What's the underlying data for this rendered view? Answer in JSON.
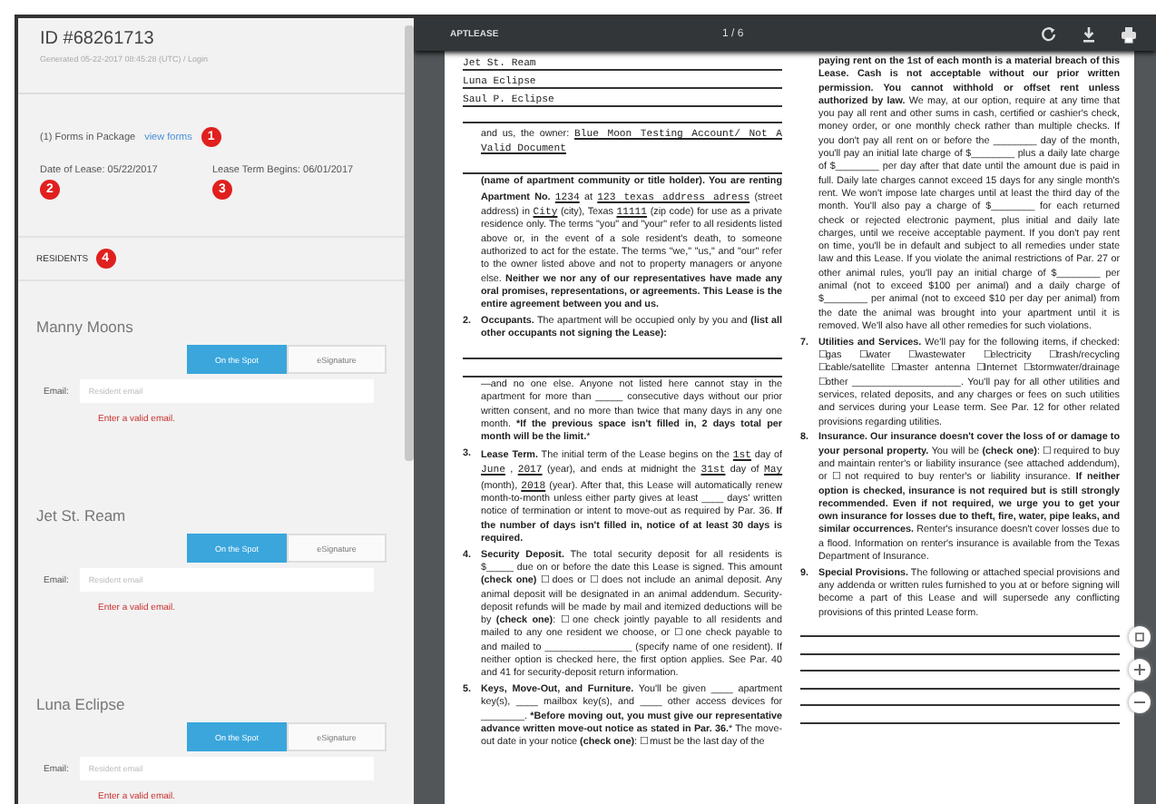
{
  "lease": {
    "id": "ID #68261713",
    "generated": "Generated 05-22-2017 08:45:28 (UTC) / Login",
    "forms_label": "(1) Forms in Package",
    "forms_link": "view forms",
    "date_of_lease_label": "Date of Lease:",
    "date_of_lease": "05/22/2017",
    "term_begins_label": "Lease Term Begins:",
    "term_begins": "06/01/2017",
    "residents_heading": "RESIDENTS"
  },
  "callouts": [
    "1",
    "2",
    "3",
    "4"
  ],
  "residents": [
    {
      "name": "Manny Moons",
      "options": [
        {
          "label": "On the Spot",
          "selected": true
        },
        {
          "label": "eSignature",
          "selected": false
        }
      ],
      "email_label": "Email:",
      "email_placeholder": "Resident email",
      "error": "Enter a valid email."
    },
    {
      "name": "Jet St. Ream",
      "options": [
        {
          "label": "On the Spot",
          "selected": true
        },
        {
          "label": "eSignature",
          "selected": false
        }
      ],
      "email_label": "Email:",
      "email_placeholder": "Resident email",
      "error": "Enter a valid email."
    },
    {
      "name": "Luna Eclipse",
      "options": [
        {
          "label": "On the Spot",
          "selected": true
        },
        {
          "label": "eSignature",
          "selected": false
        }
      ],
      "email_label": "Email:",
      "email_placeholder": "Resident email",
      "error": "Enter a valid email."
    }
  ],
  "viewer": {
    "title": "APTLEASE",
    "page": "1 / 6"
  },
  "document": {
    "columns": [
      [
        {
          "kind": "fill_line",
          "text": "Jet St. Ream"
        },
        {
          "kind": "fill_line",
          "text": "Luna Eclipse"
        },
        {
          "kind": "fill_line",
          "text": "Saul P. Eclipse"
        },
        {
          "kind": "rule"
        },
        {
          "kind": "para",
          "parts": [
            {
              "kind": "text",
              "text": "and us, the owner:"
            },
            {
              "kind": "fill",
              "text": "Blue Moon Testing Account/ Not A Valid Document"
            }
          ]
        },
        {
          "kind": "rule"
        },
        {
          "kind": "para",
          "parts": [
            {
              "kind": "text",
              "text": "**(name of apartment community or title holder). You are renting Apartment No.**"
            },
            {
              "kind": "fill",
              "text": "1234"
            },
            {
              "kind": "text",
              "text": "at"
            },
            {
              "kind": "fill",
              "text": "123 texas address adress"
            },
            {
              "kind": "text",
              "text": "(street address) in"
            },
            {
              "kind": "fill",
              "text": "City"
            },
            {
              "kind": "text",
              "text": "(city), Texas"
            },
            {
              "kind": "fill",
              "text": "11111"
            },
            {
              "kind": "text",
              "text": "(zip code) for use as a private residence only. The terms \"you\" and \"your\" refer to all residents listed above or, in the event of a sole resident's death, to someone authorized to act for the estate. The terms \"we,\" \"us,\" and \"our\" refer to the owner listed above and not to property managers or anyone else. **Neither we nor any of our representatives have made any oral promises, representations, or agreements. This Lease is the entire agreement between you and us.**"
            }
          ]
        },
        {
          "kind": "para",
          "number": "2.",
          "parts": [
            {
              "kind": "text",
              "text": "**Occupants.** The apartment will be occupied only by you and **(list all other occupants not signing the Lease):**"
            }
          ]
        },
        {
          "kind": "rule"
        },
        {
          "kind": "rule"
        },
        {
          "kind": "para",
          "parts": [
            {
              "kind": "text",
              "text": "—and no one else. Anyone not listed here cannot stay in the apartment for more than _____ consecutive days without our prior written consent, and no more than twice that many days in any one month. ***If the previous space isn't filled in, 2 days total per month will be the limit.***"
            }
          ]
        },
        {
          "kind": "para",
          "number": "3.",
          "parts": [
            {
              "kind": "text",
              "text": "**Lease Term.** The initial term of the Lease begins on the"
            },
            {
              "kind": "fill",
              "text": "1st"
            },
            {
              "kind": "text",
              "text": "day of"
            },
            {
              "kind": "fill",
              "text": "June"
            },
            {
              "kind": "text",
              "text": ","
            },
            {
              "kind": "fill",
              "text": "2017"
            },
            {
              "kind": "text",
              "text": "(year), and ends at midnight the"
            },
            {
              "kind": "fill",
              "text": "31st"
            },
            {
              "kind": "text",
              "text": "day of"
            },
            {
              "kind": "fill",
              "text": "May"
            },
            {
              "kind": "text",
              "text": "(month),"
            },
            {
              "kind": "fill",
              "text": "2018"
            },
            {
              "kind": "text",
              "text": "(year). After that, this Lease will automatically renew month-to-month unless either party gives at least ____ days' written notice of termination or intent to move-out as required by Par. 36. **If the number of days isn't filled in, notice of at least 30 days is required.**"
            }
          ]
        },
        {
          "kind": "para",
          "number": "4.",
          "parts": [
            {
              "kind": "text",
              "text": "**Security Deposit.** The total security deposit for all residents is $_____ due on or before the date this Lease is signed. This amount **(check one)** ☐ does or ☐ does not include an animal deposit. Any animal deposit will be designated in an animal addendum. Security-deposit refunds will be made by mail and itemized deductions will be by **(check one)**: ☐ one check jointly payable to all residents and mailed to any one resident we choose, or ☐ one check payable to and mailed to ________________ (specify name of one resident). If neither option is checked here, the first option applies. See Par. 40 and 41 for security-deposit return information."
            }
          ]
        },
        {
          "kind": "para",
          "number": "5.",
          "parts": [
            {
              "kind": "text",
              "text": "**Keys, Move-Out, and Furniture.** You'll be given ____ apartment key(s), ____ mailbox key(s), and ____ other access devices for ________. ***Before moving out, you must give our representative advance written move-out notice as stated in Par. 36.*** The move-out date in your notice **(check one)**: ☐ must be the last day of the"
            }
          ]
        }
      ],
      [
        {
          "kind": "para",
          "parts": [
            {
              "kind": "text",
              "text": "**paying rent on the 1st of each month is a material breach of this Lease. Cash is not acceptable without our prior written permission. You cannot withhold or offset rent unless authorized by law.** We may, at our option, require at any time that you pay all rent and other sums in cash, certified or cashier's check, money order, or one monthly check rather than multiple checks. If you don't pay all rent on or before the ________ day of the month, you'll pay an initial late charge of $________ plus a daily late charge of $________ per day after that date until the amount due is paid in full. Daily late charges cannot exceed 15 days for any single month's rent. We won't impose late charges until at least the third day of the month. You'll also pay a charge of $________ for each returned check or rejected electronic payment, plus initial and daily late charges, until we receive acceptable payment. If you don't pay rent on time, you'll be in default and subject to all remedies under state law and this Lease. If you violate the animal restrictions of Par. 27 or other animal rules, you'll pay an initial charge of $________ per animal (not to exceed $100 per animal) and a daily charge of $________ per animal (not to exceed $10 per day per animal) from the date the animal was brought into your apartment until it is removed. We'll also have all other remedies for such violations."
            }
          ]
        },
        {
          "kind": "para",
          "number": "7.",
          "parts": [
            {
              "kind": "text",
              "text": "**Utilities and Services.** We'll pay for the following items, if checked: ☐gas ☐water ☐wastewater ☐electricity ☐trash/recycling ☐cable/satellite ☐master antenna ☐Internet ☐stormwater/drainage ☐other ____________________. You'll pay for all other utilities and services, related deposits, and any charges or fees on such utilities and services during your Lease term. See Par. 12 for other related provisions regarding utilities."
            }
          ]
        },
        {
          "kind": "para",
          "number": "8.",
          "parts": [
            {
              "kind": "text",
              "text": "**Insurance. Our insurance doesn't cover the loss of or damage to your personal property.** You will be **(check one)**: ☐ required to buy and maintain renter's or liability insurance (see attached addendum), or ☐ not required to buy renter's or liability insurance. **If neither option is checked, insurance is not required but is still strongly recommended. Even if not required, we urge you to get your own insurance for losses due to theft, fire, water, pipe leaks, and similar occurrences.** Renter's insurance doesn't cover losses due to a flood. Information on renter's insurance is available from the Texas Department of Insurance."
            }
          ]
        },
        {
          "kind": "para",
          "number": "9.",
          "parts": [
            {
              "kind": "text",
              "text": "**Special Provisions.** The following or attached special provisions and any addenda or written rules furnished to you at or before signing will become a part of this Lease and will supersede any conflicting provisions of this printed Lease form."
            }
          ]
        },
        {
          "kind": "rule"
        },
        {
          "kind": "rule"
        },
        {
          "kind": "rule"
        },
        {
          "kind": "rule"
        },
        {
          "kind": "rule"
        },
        {
          "kind": "rule"
        }
      ]
    ]
  }
}
